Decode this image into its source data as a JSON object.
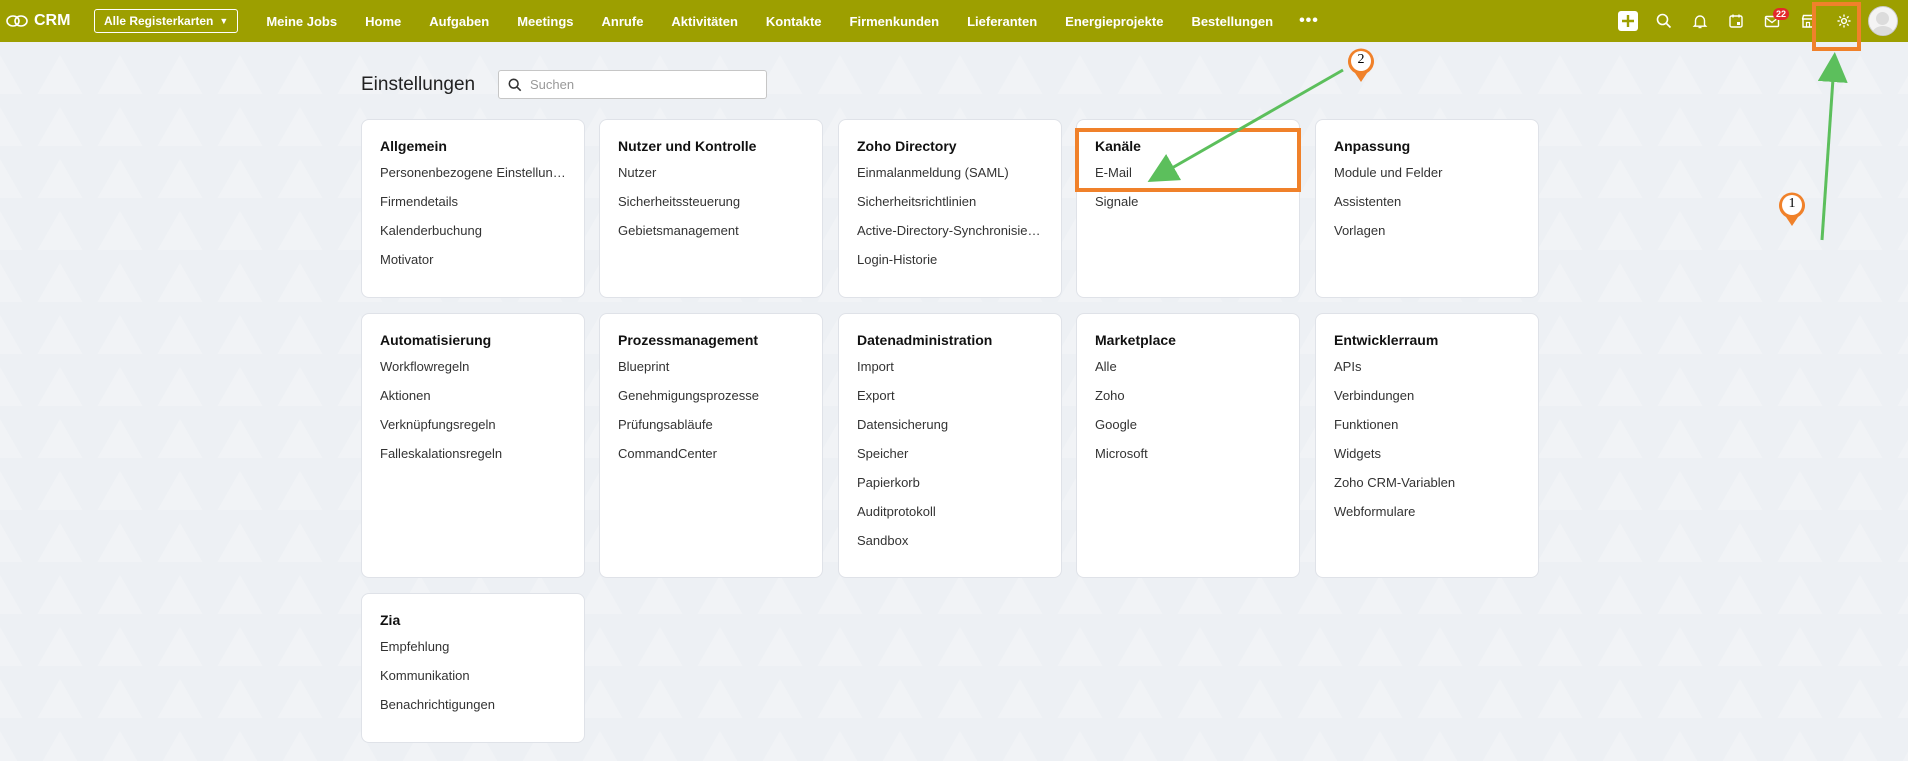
{
  "app": {
    "brand": "CRM",
    "all_tabs_label": "Alle Registerkarten"
  },
  "nav": {
    "items": [
      "Meine Jobs",
      "Home",
      "Aufgaben",
      "Meetings",
      "Anrufe",
      "Aktivitäten",
      "Kontakte",
      "Firmenkunden",
      "Lieferanten",
      "Energieprojekte",
      "Bestellungen"
    ],
    "more": "•••"
  },
  "tools": {
    "icons": [
      "plus-icon",
      "search-icon",
      "bell-icon",
      "calendar-icon",
      "mail-icon",
      "store-icon",
      "gear-icon"
    ],
    "mail_badge": "22"
  },
  "header": {
    "title": "Einstellungen",
    "search_placeholder": "Suchen"
  },
  "cards": [
    {
      "title": "Allgemein",
      "items": [
        "Personenbezogene Einstellungen",
        "Firmendetails",
        "Kalenderbuchung",
        "Motivator"
      ]
    },
    {
      "title": "Nutzer und Kontrolle",
      "items": [
        "Nutzer",
        "Sicherheitssteuerung",
        "Gebietsmanagement"
      ]
    },
    {
      "title": "Zoho Directory",
      "items": [
        "Einmalanmeldung (SAML)",
        "Sicherheitsrichtlinien",
        "Active-Directory-Synchronisierung",
        "Login-Historie"
      ]
    },
    {
      "title": "Kanäle",
      "items": [
        "E-Mail",
        "Signale"
      ]
    },
    {
      "title": "Anpassung",
      "items": [
        "Module und Felder",
        "Assistenten",
        "Vorlagen"
      ]
    },
    {
      "title": "Automatisierung",
      "items": [
        "Workflowregeln",
        "Aktionen",
        "Verknüpfungsregeln",
        "Falleskalationsregeln"
      ]
    },
    {
      "title": "Prozessmanagement",
      "items": [
        "Blueprint",
        "Genehmigungsprozesse",
        "Prüfungsabläufe",
        "CommandCenter"
      ]
    },
    {
      "title": "Datenadministration",
      "items": [
        "Import",
        "Export",
        "Datensicherung",
        "Speicher",
        "Papierkorb",
        "Auditprotokoll",
        "Sandbox"
      ]
    },
    {
      "title": "Marketplace",
      "items": [
        "Alle",
        "Zoho",
        "Google",
        "Microsoft"
      ]
    },
    {
      "title": "Entwicklerraum",
      "items": [
        "APIs",
        "Verbindungen",
        "Funktionen",
        "Widgets",
        "Zoho CRM-Variablen",
        "Webformulare"
      ]
    },
    {
      "title": "Zia",
      "items": [
        "Empfehlung",
        "Kommunikation",
        "Benachrichtigungen"
      ]
    }
  ],
  "annotations": {
    "marker_1": "1",
    "marker_2": "2",
    "accent_orange": "#f0812a",
    "arrow_green": "#5cbf5c"
  },
  "colors": {
    "topbar": "#9d9f00",
    "background": "#eef0f4"
  }
}
